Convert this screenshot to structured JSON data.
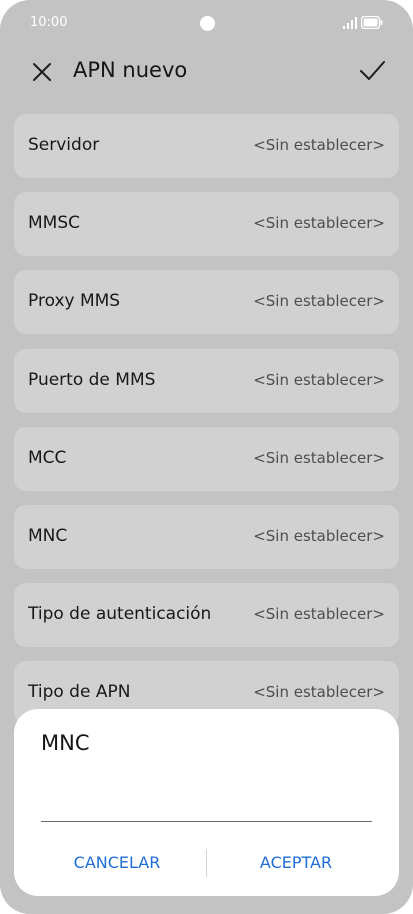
{
  "status_bar": {
    "time": "10:00",
    "icons": [
      "signal-icon",
      "battery-icon"
    ]
  },
  "app_bar": {
    "title": "APN nuevo",
    "close_icon": "close-icon",
    "confirm_icon": "check-icon"
  },
  "settings": [
    {
      "label": "Servidor",
      "value": "<Sin establecer>"
    },
    {
      "label": "MMSC",
      "value": "<Sin establecer>"
    },
    {
      "label": "Proxy MMS",
      "value": "<Sin establecer>"
    },
    {
      "label": "Puerto de MMS",
      "value": "<Sin establecer>"
    },
    {
      "label": "MCC",
      "value": "<Sin establecer>"
    },
    {
      "label": "MNC",
      "value": "<Sin establecer>"
    },
    {
      "label": "Tipo de autenticación",
      "value": "<Sin establecer>"
    },
    {
      "label": "Tipo de APN",
      "value": "<Sin establecer>"
    }
  ],
  "dialog": {
    "title": "MNC",
    "input_value": "",
    "cancel_label": "CANCELAR",
    "accept_label": "ACEPTAR"
  },
  "colors": {
    "accent": "#1f6dd6",
    "background": "#c3c3c3",
    "row": "#d1d1d1"
  }
}
